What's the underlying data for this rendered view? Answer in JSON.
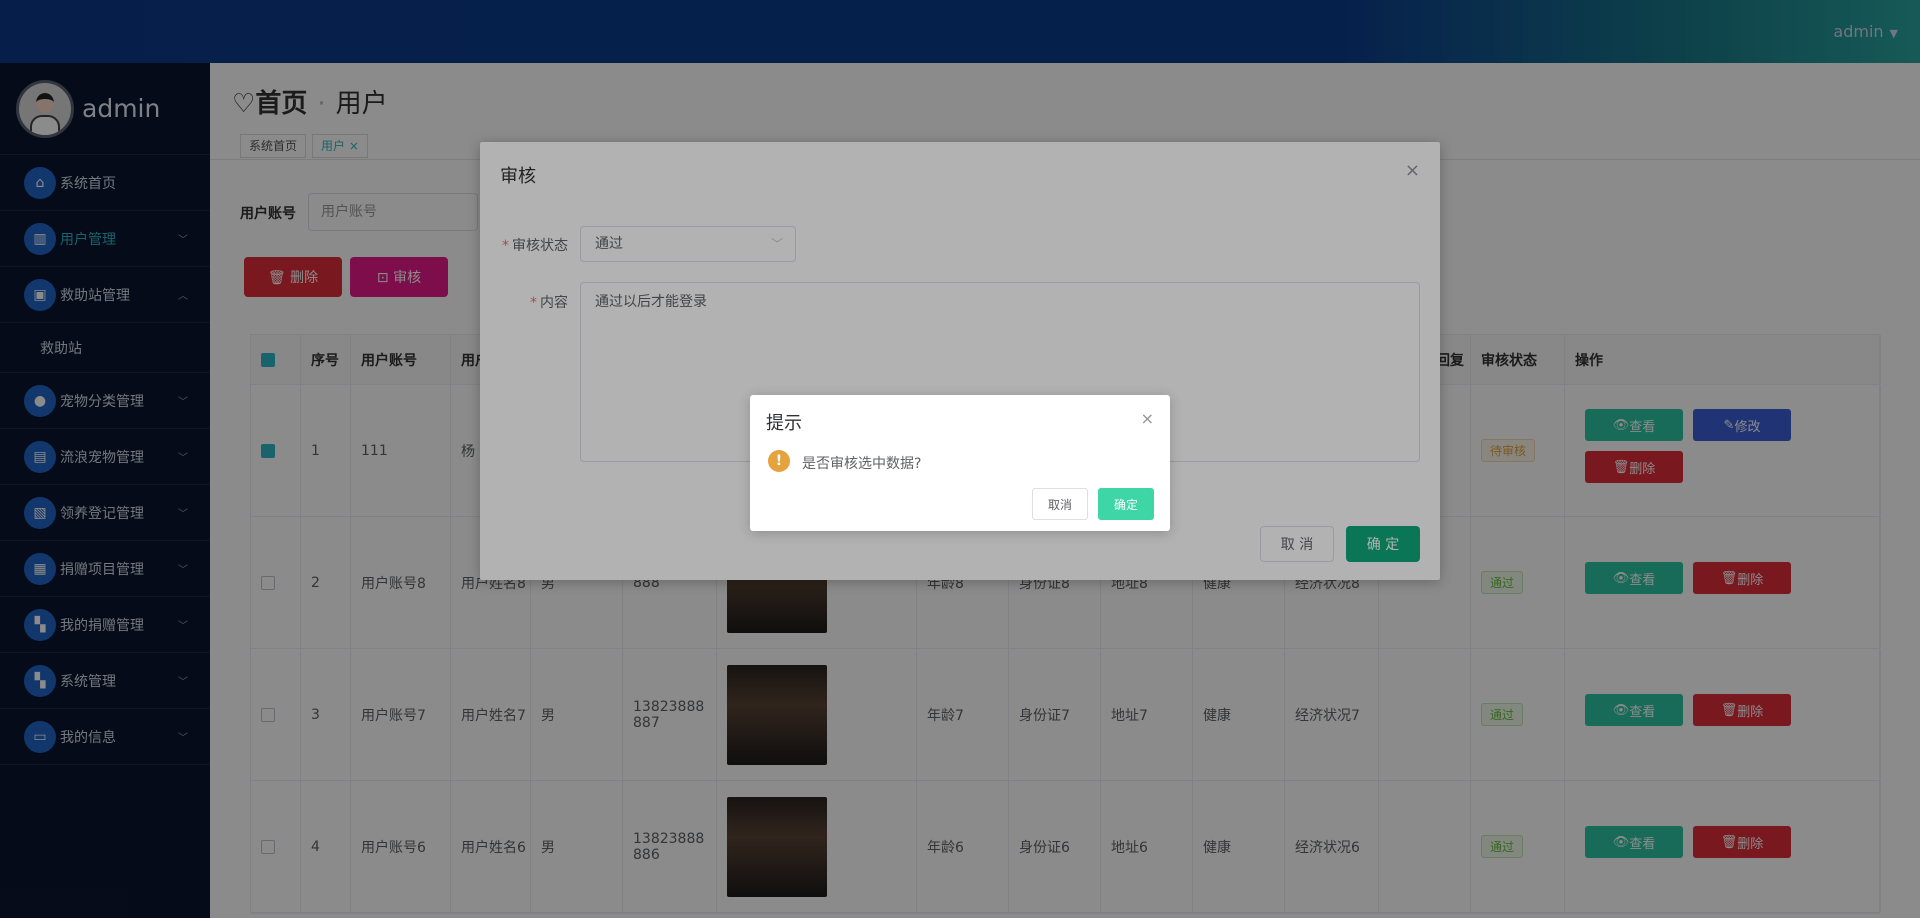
{
  "header": {
    "user": "admin",
    "caret": "▼"
  },
  "sidebar": {
    "profile_name": "admin",
    "items": [
      {
        "label": "系统首页",
        "icon": "home-icon",
        "glyph": "⌂",
        "chevron": "",
        "active": false
      },
      {
        "label": "用户管理",
        "icon": "chart-icon",
        "glyph": "▥",
        "chevron": "﹀",
        "active": true
      },
      {
        "label": "救助站管理",
        "icon": "briefcase-icon",
        "glyph": "▣",
        "chevron": "︿",
        "active": false
      },
      {
        "label": "宠物分类管理",
        "icon": "user-icon",
        "glyph": "●",
        "chevron": "﹀",
        "active": false
      },
      {
        "label": "流浪宠物管理",
        "icon": "clipboard-icon",
        "glyph": "▤",
        "chevron": "﹀",
        "active": false
      },
      {
        "label": "领养登记管理",
        "icon": "chart-line-icon",
        "glyph": "▧",
        "chevron": "﹀",
        "active": false
      },
      {
        "label": "捐赠项目管理",
        "icon": "list-icon",
        "glyph": "▦",
        "chevron": "﹀",
        "active": false
      },
      {
        "label": "我的捐赠管理",
        "icon": "grid-icon",
        "glyph": "▚",
        "chevron": "﹀",
        "active": false
      },
      {
        "label": "系统管理",
        "icon": "grid-icon",
        "glyph": "▚",
        "chevron": "﹀",
        "active": false
      },
      {
        "label": "我的信息",
        "icon": "card-icon",
        "glyph": "▭",
        "chevron": "﹀",
        "active": false
      }
    ],
    "sub_item": "救助站"
  },
  "page": {
    "heart": "♡",
    "title": "首页",
    "sep": "·",
    "subtitle": "用户",
    "tags": [
      "系统首页",
      "用户 ×"
    ]
  },
  "search": {
    "label": "用户账号",
    "placeholder": "用户账号"
  },
  "toolbar": {
    "delete_label": "🗑 删除",
    "audit_label": "⊡ 审核"
  },
  "table": {
    "headers": [
      "序号",
      "用户账号",
      "用户",
      "审核状态",
      "操作",
      "回复"
    ],
    "rows": [
      {
        "no": "1",
        "account": "111",
        "name": "杨",
        "gender": "",
        "phone_l1": "",
        "phone_l2": "",
        "age": "",
        "id": "",
        "addr": "",
        "health": "",
        "econ": "",
        "status": "待审核",
        "status_class": "pending",
        "checked": true,
        "ops": [
          "查看",
          "修改",
          "删除"
        ]
      },
      {
        "no": "2",
        "account": "用户账号8",
        "name": "用户姓名8",
        "gender": "男",
        "phone_l1": "",
        "phone_l2": "888",
        "age": "年龄8",
        "id": "身份证8",
        "addr": "地址8",
        "health": "健康",
        "econ": "经济状况8",
        "status": "通过",
        "status_class": "pass",
        "checked": false,
        "ops": [
          "查看",
          "删除"
        ]
      },
      {
        "no": "3",
        "account": "用户账号7",
        "name": "用户姓名7",
        "gender": "男",
        "phone_l1": "13823888",
        "phone_l2": "887",
        "age": "年龄7",
        "id": "身份证7",
        "addr": "地址7",
        "health": "健康",
        "econ": "经济状况7",
        "status": "通过",
        "status_class": "pass",
        "checked": false,
        "ops": [
          "查看",
          "删除"
        ]
      },
      {
        "no": "4",
        "account": "用户账号6",
        "name": "用户姓名6",
        "gender": "男",
        "phone_l1": "13823888",
        "phone_l2": "886",
        "age": "年龄6",
        "id": "身份证6",
        "addr": "地址6",
        "health": "健康",
        "econ": "经济状况6",
        "status": "通过",
        "status_class": "pass",
        "checked": false,
        "ops": [
          "查看",
          "删除"
        ]
      }
    ]
  },
  "dialog": {
    "title": "审核",
    "close": "×",
    "status_label": "审核状态",
    "status_value": "通过",
    "content_label": "内容",
    "content_value": "通过以后才能登录",
    "cancel_label": "取 消",
    "ok_label": "确 定",
    "arrow": "﹀",
    "required": "*"
  },
  "msgbox": {
    "title": "提示",
    "close": "×",
    "icon_glyph": "!",
    "message": "是否审核选中数据?",
    "cancel_label": "取消",
    "ok_label": "确定"
  }
}
